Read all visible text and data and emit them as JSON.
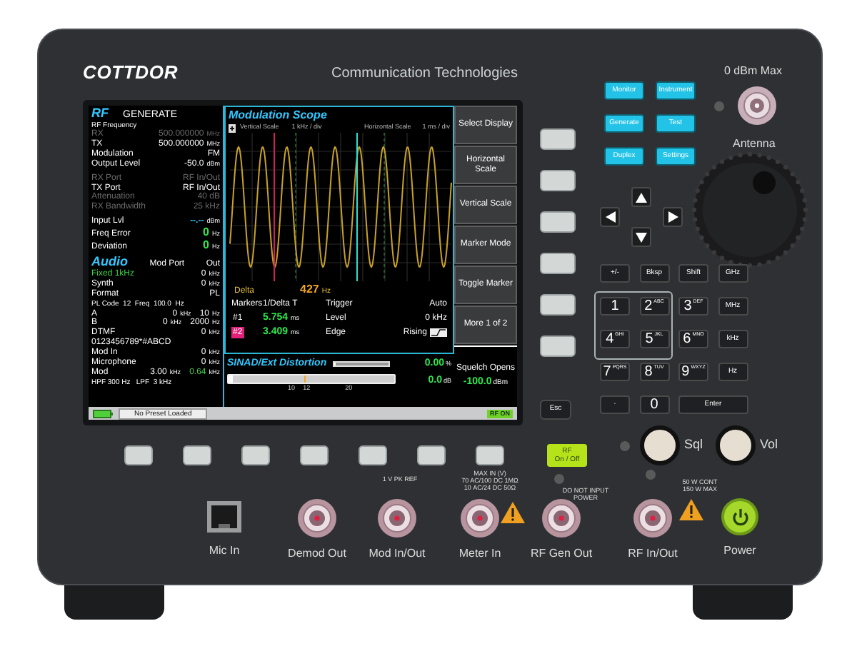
{
  "brand": {
    "logo": "COTTDOR",
    "tagline": "Communication Technologies"
  },
  "antenna": {
    "rating": "0 dBm Max",
    "label": "Antenna"
  },
  "screen": {
    "rf": {
      "title": "RF",
      "mode": "GENERATE",
      "caption": "RF Frequency",
      "groups": [
        [
          {
            "kind": "field",
            "label": "RX",
            "value": "500.000000",
            "unit": "MHz",
            "disabled": true
          },
          {
            "kind": "field",
            "label": "TX",
            "value": "500.000000",
            "unit": "MHz",
            "disabled": false
          },
          {
            "kind": "field",
            "label": "Modulation",
            "value": "FM",
            "disabled": false
          },
          {
            "kind": "field",
            "label": "Output Level",
            "value": "-50.0",
            "unit": "dBm",
            "disabled": false
          }
        ],
        [
          {
            "kind": "field",
            "label": "RX Port",
            "value": "RF In/Out",
            "disabled": true
          },
          {
            "kind": "field",
            "label": "TX Port",
            "value": "RF In/Out",
            "disabled": false
          },
          {
            "kind": "field",
            "label": "Attenuation",
            "value": "40 dB",
            "disabled": true
          },
          {
            "kind": "field",
            "label": "RX Bandwidth",
            "value": "25 kHz",
            "disabled": true
          }
        ],
        [
          {
            "kind": "live",
            "label": "Input Lvl",
            "value": "--.--",
            "unit": "dBm",
            "disabled": false
          },
          {
            "kind": "reading",
            "label": "Freq Error",
            "value": "0",
            "unit": "Hz",
            "disabled": false
          },
          {
            "kind": "reading",
            "label": "Deviation",
            "value": "0",
            "unit": "Hz",
            "disabled": false
          }
        ]
      ]
    },
    "audio": {
      "title": "Audio",
      "port_label": "Mod Port",
      "port_value": "Out",
      "rows": [
        {
          "kind": "tone",
          "label": "Fixed 1kHz",
          "value": "0",
          "unit": "kHz"
        },
        {
          "kind": "field",
          "label": "Synth",
          "value": "0",
          "unit": "kHz"
        },
        {
          "kind": "field",
          "label": "Format",
          "value": "PL"
        },
        {
          "kind": "note",
          "text": "PL Code  12  Freq  100.0  Hz"
        },
        {
          "kind": "field",
          "label": "A",
          "value": "0",
          "unit": "kHz",
          "extra": "10",
          "extra_unit": "Hz"
        },
        {
          "kind": "field",
          "label": "B",
          "value": "0",
          "unit": "kHz",
          "extra": "2000",
          "extra_unit": "Hz"
        },
        {
          "kind": "field",
          "label": "DTMF",
          "value": "0",
          "unit": "kHz"
        },
        {
          "kind": "code",
          "text": "0123456789*#ABCD"
        },
        {
          "kind": "field",
          "label": "Mod In",
          "value": "0",
          "unit": "kHz"
        },
        {
          "kind": "field",
          "label": "Microphone",
          "value": "0",
          "unit": "kHz"
        },
        {
          "kind": "dual",
          "label": "Mod",
          "value": "3.00",
          "unit": "kHz",
          "extra": "0.64",
          "extra_unit": "kHz"
        },
        {
          "kind": "note",
          "text": "HPF 300 Hz   LPF  3 kHz"
        }
      ]
    },
    "scope": {
      "title": "Modulation Scope",
      "vertical_scale": {
        "label": "Vertical Scale",
        "value": "1 kHz / div"
      },
      "horizontal_scale": {
        "label": "Horizontal Scale",
        "value": "1 ms / div"
      },
      "delta": {
        "label": "Delta",
        "value": "427",
        "unit": "Hz"
      },
      "markers": {
        "label": "Markers",
        "mode": "1/Delta T",
        "items": [
          {
            "label": "#1",
            "value": "5.754",
            "unit": "ms",
            "selected": false
          },
          {
            "label": "#2",
            "value": "3.409",
            "unit": "ms",
            "selected": true
          }
        ]
      },
      "trigger": {
        "label": "Trigger",
        "value": "Auto",
        "rows": [
          {
            "kind": "level",
            "label": "Level",
            "value": "0 kHz"
          },
          {
            "kind": "edge",
            "label": "Edge",
            "value": "Rising"
          }
        ]
      }
    },
    "sinad": {
      "title": "SINAD/Ext Distortion",
      "readings": [
        {
          "value": "0.00",
          "unit": "%",
          "level": 0.03
        },
        {
          "value": "0.0",
          "unit": "dB",
          "level": 0.03
        }
      ],
      "ticks": [
        "10",
        "12",
        "20"
      ]
    },
    "softkeys": [
      "Select Display",
      "Horizontal Scale",
      "Vertical Scale",
      "Marker Mode",
      "Toggle Marker",
      "More 1 of 2"
    ],
    "squelch": {
      "label": "Squelch Opens",
      "value": "-100.0",
      "unit": "dBm"
    },
    "status": {
      "preset": "No Preset Loaded",
      "rf_badge": "RF ON"
    }
  },
  "mode_keys": [
    "Monitor",
    "Instrument",
    "Generate",
    "Test",
    "Duplex",
    "Settings"
  ],
  "esc_key": "Esc",
  "keypad": [
    {
      "kind": "key",
      "label": "+/-"
    },
    {
      "kind": "key",
      "label": "Bksp"
    },
    {
      "kind": "key",
      "label": "Shift"
    },
    {
      "kind": "key",
      "label": "GHz"
    },
    {
      "kind": "digit",
      "label": "1"
    },
    {
      "kind": "digit",
      "label": "2",
      "sub": "ABC"
    },
    {
      "kind": "digit",
      "label": "3",
      "sub": "DEF"
    },
    {
      "kind": "key",
      "label": "MHz"
    },
    {
      "kind": "digit",
      "label": "4",
      "sub": "GHI"
    },
    {
      "kind": "digit",
      "label": "5",
      "sub": "JKL"
    },
    {
      "kind": "digit",
      "label": "6",
      "sub": "MNO"
    },
    {
      "kind": "key",
      "label": "kHz"
    },
    {
      "kind": "digit",
      "label": "7",
      "sub": "PQRS"
    },
    {
      "kind": "digit",
      "label": "8",
      "sub": "TUV"
    },
    {
      "kind": "digit",
      "label": "9",
      "sub": "WXYZ"
    },
    {
      "kind": "key",
      "label": "Hz"
    },
    {
      "kind": "key",
      "label": "·"
    },
    {
      "kind": "digit",
      "label": "0"
    },
    {
      "kind": "wide",
      "label": "Enter"
    }
  ],
  "rf_key": {
    "label": "RF",
    "sub": "On / Off"
  },
  "knobs": [
    "Sql",
    "Vol"
  ],
  "notes": [
    {
      "lines": [
        "1 V PK REF"
      ]
    },
    {
      "lines": [
        "MAX IN (V)",
        "70 AC/100 DC 1MΩ",
        "10 AC/24 DC 50Ω"
      ]
    },
    {
      "lines": [
        "DO NOT INPUT",
        "POWER"
      ]
    },
    {
      "lines": [
        "50 W CONT",
        "150 W MAX"
      ]
    }
  ],
  "ports": [
    {
      "kind": "ethernet",
      "label": "Mic In"
    },
    {
      "kind": "bnc",
      "label": "Demod Out"
    },
    {
      "kind": "bnc",
      "label": "Mod In/Out"
    },
    {
      "kind": "bnc",
      "label": "Meter In"
    },
    {
      "kind": "bnc",
      "label": "RF Gen Out"
    },
    {
      "kind": "bnc",
      "label": "RF In/Out"
    },
    {
      "kind": "power",
      "label": "Power"
    }
  ]
}
